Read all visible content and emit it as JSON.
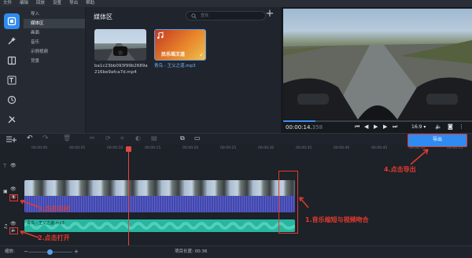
{
  "menu": [
    "文件",
    "编辑",
    "回放",
    "设置",
    "导出",
    "帮助"
  ],
  "categories": [
    "导入",
    "媒体区",
    "画面",
    "音乐",
    "示例视频",
    "背景"
  ],
  "media": {
    "title": "媒体区",
    "search_placeholder": "查找",
    "items": [
      {
        "name": "ba1c23bb093f99b2689a216be9afca7d.mp4",
        "type": "video"
      },
      {
        "name": "青鸟 - 王父之道.mp3",
        "type": "audio",
        "cover_text": "民乐瑶王道"
      }
    ]
  },
  "preview": {
    "timecode_main": "00:00:14.",
    "timecode_ms": "358",
    "aspect": "16:9",
    "progress": 0.17
  },
  "toolbar": {
    "export_label": "导出"
  },
  "ruler": [
    "00:00:00",
    "00:00:05",
    "00:00:10",
    "00:00:15",
    "00:00:20",
    "00:00:25",
    "00:00:30",
    "00:00:35",
    "00:00:40",
    "00:00:45",
    "00:00:50",
    "00:00:55"
  ],
  "audio_clip_label": "青鸟 - 王父之道.mp3",
  "annotations": {
    "a1": "1.音乐缩短与视频吻合",
    "a2": "2.点击打开",
    "a3": "3.点击关闭",
    "a4": "4.点击导出"
  },
  "status": {
    "scale_label": "缩放:",
    "duration_label": "项目长度: 00:36"
  },
  "colors": {
    "accent": "#2f8bf0",
    "annotation": "#e23b2e",
    "video_track": "#4b4fb8",
    "audio_track": "#27b6a0"
  }
}
